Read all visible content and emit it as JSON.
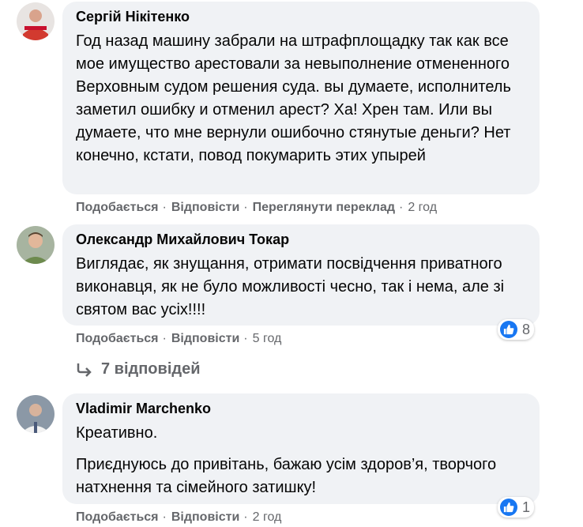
{
  "comments": [
    {
      "author": "Сергій Нікітенко",
      "avatar_icon": "user-avatar-red",
      "text": "Год назад машину забрали на штрафплощадку так как все мое имущество арестовали за невыполнение отмененного Верховным судом решения суда. вы думаете, исполнитель заметил ошибку и отменил арест? Ха! Хрен там. Или вы думаете, что мне вернули ошибочно стянутые деньги? Нет конечно, кстати, повод покумарить этих упырей",
      "actions": {
        "like": "Подобається",
        "reply": "Відповісти",
        "translate": "Переглянути переклад",
        "time": "2 год"
      }
    },
    {
      "author": "Олександр Михайлович Токар",
      "avatar_icon": "user-avatar-photo",
      "text": "Виглядає, як знущання, отримати посвідчення приватного виконавця, як не було можливості чесно, так і нема, але зі святом вас усіх!!!!",
      "reaction_count": "8",
      "actions": {
        "like": "Подобається",
        "reply": "Відповісти",
        "time": "5 год"
      }
    },
    {
      "author": "Vladimir Marchenko",
      "avatar_icon": "user-avatar-photo",
      "text_paragraphs": [
        "Креативно.",
        "Приєднуюсь до привітань, бажаю усім здоров’я, творчого натхнення та сімейного затишку!"
      ],
      "reaction_count": "1",
      "actions": {
        "like": "Подобається",
        "reply": "Відповісти",
        "time": "2 год"
      }
    }
  ],
  "replies_link": "7 відповідей",
  "colors": {
    "bubble": "#f0f2f5",
    "meta": "#65676b",
    "like_blue": "#1877f2"
  }
}
